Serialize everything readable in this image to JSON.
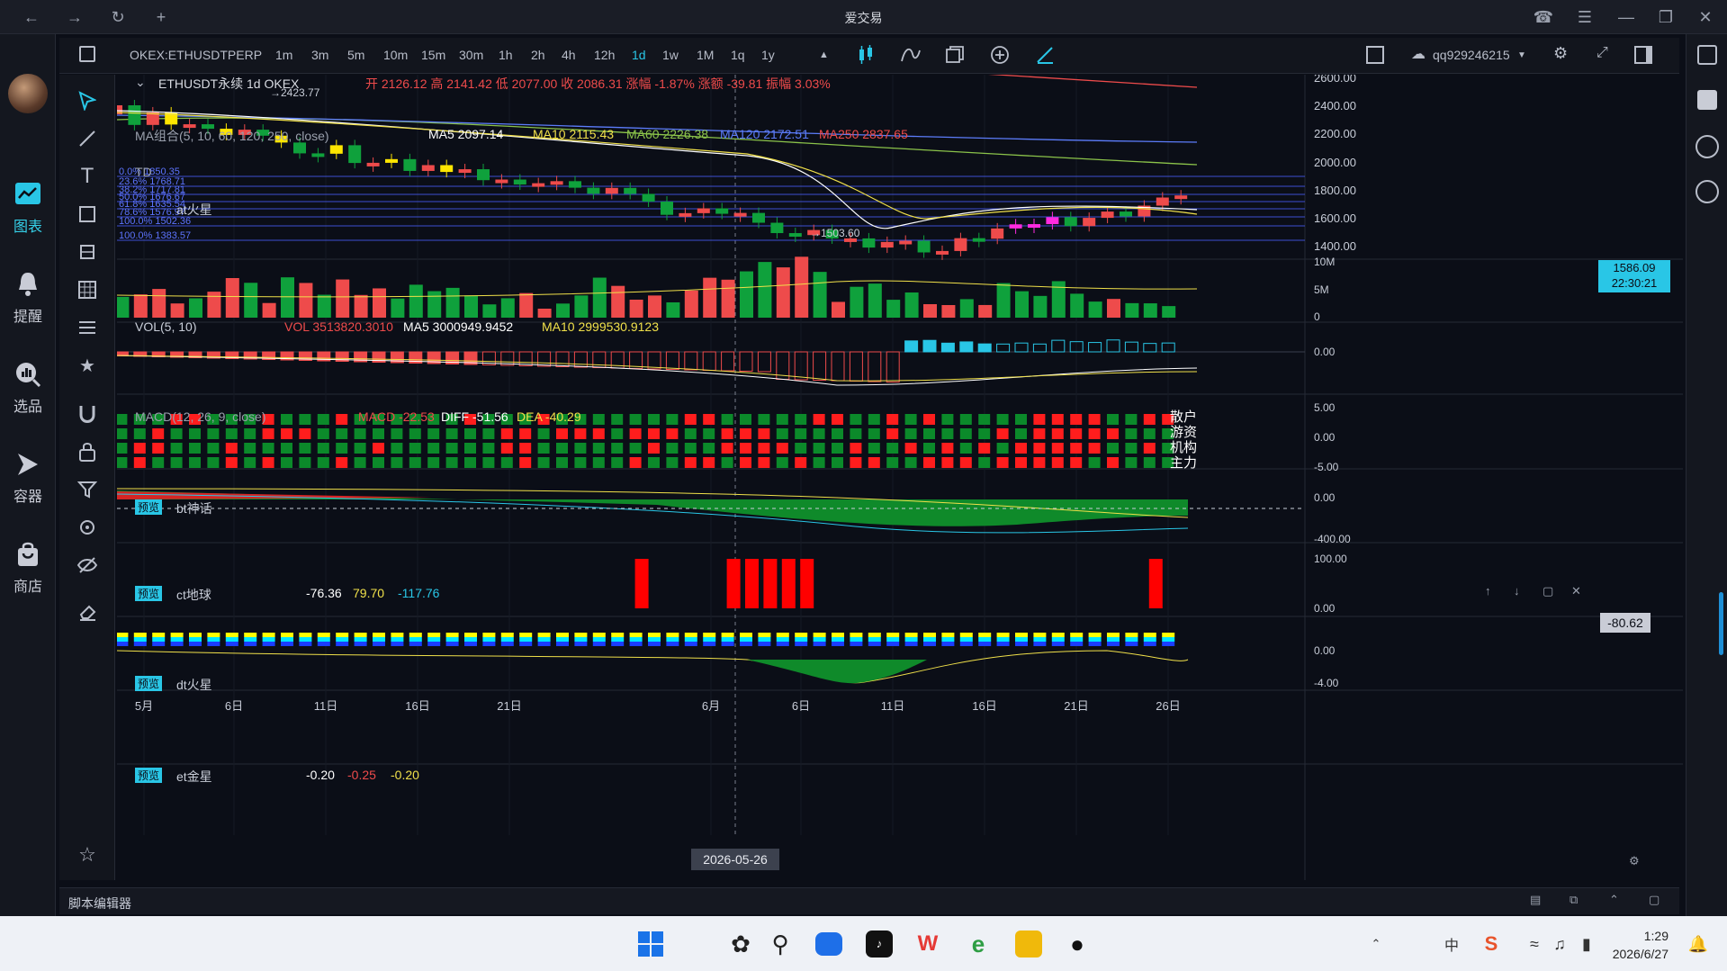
{
  "window": {
    "title": "爱交易"
  },
  "left_nav": [
    {
      "label": "图表"
    },
    {
      "label": "提醒"
    },
    {
      "label": "选品"
    },
    {
      "label": "容器"
    },
    {
      "label": "商店"
    }
  ],
  "toolbar": {
    "symbol": "OKEX:ETHUSDTPERP",
    "timeframes": [
      "1m",
      "3m",
      "5m",
      "10m",
      "15m",
      "30m",
      "1h",
      "2h",
      "4h",
      "12h",
      "1d",
      "1w",
      "1M",
      "1q",
      "1y"
    ],
    "active_timeframe": "1d",
    "account": "qq929246215"
  },
  "main_panel": {
    "symbol_line": "ETHUSDT永续 1d OKEX",
    "ohlc": "开 2126.12 高 2141.42 低 2077.00 收 2086.31 涨幅 -1.87% 涨额 -39.81 振幅 3.03%",
    "ma_label": "MA组合(5, 10, 60, 120, 250, close)",
    "ma5": "MA5 2097.14",
    "ma10": "MA10 2115.43",
    "ma60": "MA60 2226.38",
    "ma120": "MA120 2172.51",
    "ma250": "MA250 2837.65",
    "td_label": "TD",
    "fib_name": "at火星",
    "fib_levels": [
      "0.0% 1850.35",
      "23.6% 1768.71",
      "38.2% 1717.81",
      "50.0% 1676.67",
      "61.8% 1635.54",
      "78.6% 1576.97",
      "100.0% 1502.36",
      "100.0% 1383.57"
    ],
    "high_label": "→2423.77",
    "low_label": "→1503.60",
    "price_axis": [
      "2600.00",
      "2400.00",
      "2200.00",
      "2000.00",
      "1800.00",
      "1600.00",
      "1400.00"
    ],
    "last_price": "1586.09",
    "countdown": "22:30:21"
  },
  "vol_panel": {
    "label": "VOL(5, 10)",
    "vol": "VOL 3513820.3010",
    "ma5": "MA5 3000949.9452",
    "ma10": "MA10 2999530.9123",
    "axis": [
      "10M",
      "5M",
      "0"
    ]
  },
  "macd_panel": {
    "label": "MACD(12, 26, 9, close)",
    "macd": "MACD -22.53",
    "diff": "DIFF -51.56",
    "dea": "DEA -40.29",
    "axis": [
      "0.00"
    ]
  },
  "bt_panel": {
    "badge": "预览",
    "label": "bt神话",
    "axis": [
      "5.00",
      "0.00",
      "-5.00"
    ],
    "legend": [
      "散户",
      "游资",
      "机构",
      "主力"
    ]
  },
  "ct_panel": {
    "badge": "预览",
    "label": "ct地球",
    "v1": "-76.36",
    "v2": "79.70",
    "v3": "-117.76",
    "axis": [
      "0.00",
      "-400.00"
    ],
    "current": "-80.62"
  },
  "dt_panel": {
    "badge": "预览",
    "label": "dt火星",
    "axis": [
      "100.00",
      "0.00"
    ]
  },
  "et_panel": {
    "badge": "预览",
    "label": "et金星",
    "v1": "-0.20",
    "v2": "-0.25",
    "v3": "-0.20",
    "axis": [
      "0.00",
      "-4.00"
    ]
  },
  "time_axis": [
    "5月",
    "6日",
    "11日",
    "16日",
    "21日",
    "6月",
    "6日",
    "11日",
    "16日",
    "21日",
    "26日"
  ],
  "crosshair_date": "2026-05-26",
  "bottom": {
    "label": "脚本编辑器"
  },
  "taskbar": {
    "time": "1:29",
    "date": "2026/6/27"
  },
  "colors": {
    "up": "#ee4b4b",
    "down": "#0fa13c",
    "accent": "#29c6e6"
  }
}
